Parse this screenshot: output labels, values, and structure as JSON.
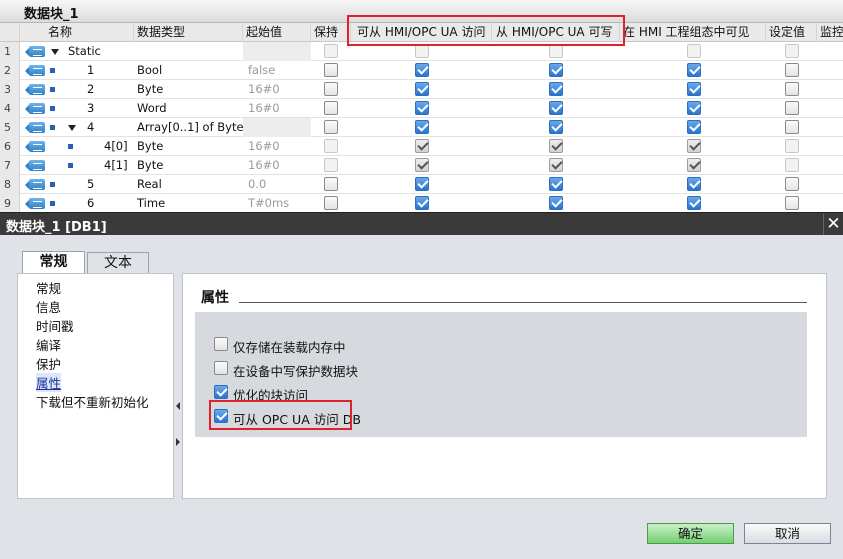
{
  "db_editor": {
    "title": "数据块_1",
    "columns": {
      "name": "名称",
      "data_type": "数据类型",
      "start_value": "起始值",
      "retain": "保持",
      "hmi_access": "可从 HMI/OPC UA 访问",
      "hmi_write": "从 HMI/OPC UA 可写",
      "hmi_visible": "在 HMI 工程组态中可见",
      "setpoint": "设定值",
      "monitor": "监控"
    },
    "rows": [
      {
        "num": "1",
        "name": "Static",
        "type": "",
        "start": ""
      },
      {
        "num": "2",
        "name": "1",
        "type": "Bool",
        "start": "false"
      },
      {
        "num": "3",
        "name": "2",
        "type": "Byte",
        "start": "16#0"
      },
      {
        "num": "4",
        "name": "3",
        "type": "Word",
        "start": "16#0"
      },
      {
        "num": "5",
        "name": "4",
        "type": "Array[0..1] of Byte",
        "start": ""
      },
      {
        "num": "6",
        "name": "4[0]",
        "type": "Byte",
        "start": "16#0"
      },
      {
        "num": "7",
        "name": "4[1]",
        "type": "Byte",
        "start": "16#0"
      },
      {
        "num": "8",
        "name": "5",
        "type": "Real",
        "start": "0.0"
      },
      {
        "num": "9",
        "name": "6",
        "type": "Time",
        "start": "T#0ms"
      }
    ]
  },
  "dialog": {
    "title": "数据块_1 [DB1]",
    "close_symbol": "✕",
    "tabs": [
      "常规",
      "文本"
    ],
    "nav_items": [
      "常规",
      "信息",
      "时间戳",
      "编译",
      "保护",
      "属性",
      "下载但不重新初始化"
    ],
    "selected_nav": "属性",
    "section_title": "属性",
    "options": [
      {
        "label": "仅存储在装载内存中",
        "checked": false
      },
      {
        "label": "在设备中写保护数据块",
        "checked": false
      },
      {
        "label": "优化的块访问",
        "checked": true
      },
      {
        "label": "可从 OPC UA 访问 DB",
        "checked": true
      }
    ],
    "ok_label": "确定",
    "cancel_label": "取消"
  },
  "colors": {
    "highlight": "#e0202a",
    "checkbox_blue": "#2b74cf",
    "ok_green": "#74cf74",
    "dialog_title_bg": "#3a3a3a"
  }
}
